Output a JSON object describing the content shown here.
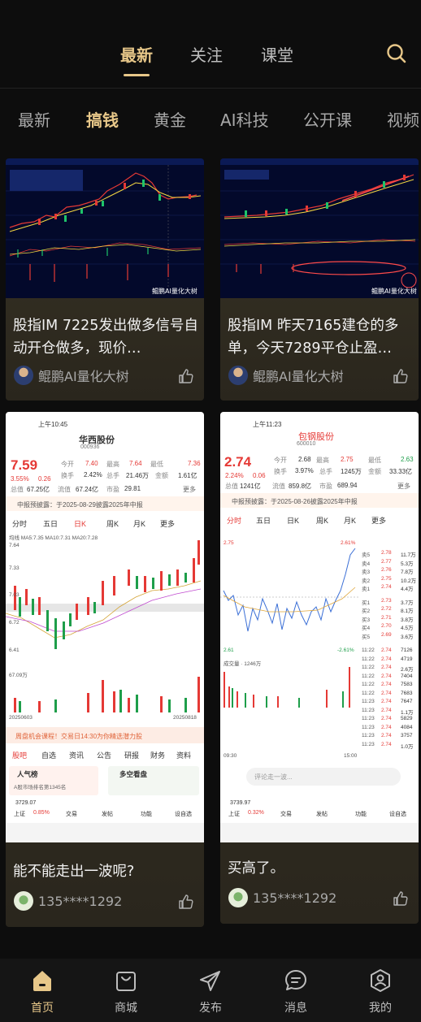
{
  "top_tabs": [
    {
      "label": "最新",
      "active": true
    },
    {
      "label": "关注",
      "active": false
    },
    {
      "label": "课堂",
      "active": false
    }
  ],
  "sub_tabs": [
    {
      "label": "最新",
      "active": false
    },
    {
      "label": "搞钱",
      "active": true
    },
    {
      "label": "黄金",
      "active": false
    },
    {
      "label": "AI科技",
      "active": false
    },
    {
      "label": "公开课",
      "active": false
    },
    {
      "label": "视频",
      "active": false
    }
  ],
  "cards": [
    {
      "title": "股指IM 7225发出做多信号自动开仓做多，现价…",
      "author": "鲲鹏AI量化大树",
      "watermark": "鲲鹏AI量化大树"
    },
    {
      "title": "股指IM 昨天7165建仓的多单，今天7289平仓止盈…",
      "author": "鲲鹏AI量化大树",
      "watermark": "鲲鹏AI量化大树"
    },
    {
      "title": "能不能走出一波呢?",
      "author": "135****1292"
    },
    {
      "title": "买高了。",
      "author": "135****1292"
    }
  ],
  "shot1": {
    "time": "上午10:45",
    "stock_name": "华西股份",
    "code": "000936",
    "price": "7.59",
    "chg_pct": "3.55%",
    "chg": "0.26",
    "open_label": "今开",
    "open": "7.40",
    "high_label": "最高",
    "high": "7.64",
    "low_label": "最低",
    "low": "7.36",
    "turnover_label": "换手",
    "turnover": "2.42%",
    "volume_label": "总手",
    "volume": "21.46万",
    "amount_label": "金额",
    "amount": "1.61亿",
    "mcap_label": "总值",
    "mcap": "67.25亿",
    "float_label": "流值",
    "float_mcap": "67.24亿",
    "pe_label": "市盈",
    "pe": "29.81",
    "more": "更多",
    "notice": "中报预披露：于2025-08-29披露2025年中报",
    "tabs": [
      "分时",
      "五日",
      "日K",
      "周K",
      "月K",
      "更多"
    ],
    "ma_line": "均线 MA5:7.35 MA10:7.31 MA20:7.28",
    "y_labels": [
      "7.64",
      "7.33",
      "7.03",
      "6.72",
      "6.41"
    ],
    "vol_label": "67.09万",
    "date_start": "20250603",
    "date_end": "20250818",
    "banner": "周盘机会课程！交易日14:30为你精选潜力股",
    "bottom_tabs": [
      "股吧",
      "自选",
      "资讯",
      "公告",
      "研报",
      "财务",
      "资料"
    ],
    "popular": "人气榜",
    "popular_sub": "A股市场排名第1345名",
    "bull_bear": "多空看盘",
    "index_name": "上证",
    "index_value": "3729.07",
    "index_pct": "0.85%",
    "nav": [
      "交易",
      "发帖",
      "功能",
      "设自选"
    ]
  },
  "shot2": {
    "time": "上午11:23",
    "stock_name": "包钢股份",
    "code": "600010",
    "price": "2.74",
    "chg_pct": "2.24%",
    "chg": "0.06",
    "open_label": "今开",
    "open": "2.68",
    "high_label": "最高",
    "high": "2.75",
    "low_label": "最低",
    "low": "2.63",
    "turnover_label": "换手",
    "turnover": "3.97%",
    "volume_label": "总手",
    "volume": "1245万",
    "amount_label": "金额",
    "amount": "33.33亿",
    "mcap_label": "总值",
    "mcap": "1241亿",
    "float_label": "流值",
    "float_mcap": "859.8亿",
    "pe_label": "市盈",
    "pe": "689.94",
    "more": "更多",
    "notice": "中报预披露：于2025-08-26披露2025年中报",
    "tabs": [
      "分时",
      "五日",
      "日K",
      "周K",
      "月K",
      "更多"
    ],
    "y_top": "2.75",
    "y_bottom": "2.61",
    "pct_top": "2.61%",
    "pct_bottom": "-2.61%",
    "order_book": [
      [
        "卖5",
        "2.78",
        "11.7万"
      ],
      [
        "卖4",
        "2.77",
        "5.3万"
      ],
      [
        "卖3",
        "2.76",
        "7.8万"
      ],
      [
        "卖2",
        "2.75",
        "10.2万"
      ],
      [
        "卖1",
        "2.74",
        "4.4万"
      ],
      [
        "买1",
        "2.73",
        "3.7万"
      ],
      [
        "买2",
        "2.72",
        "8.1万"
      ],
      [
        "买3",
        "2.71",
        "3.8万"
      ],
      [
        "买4",
        "2.70",
        "4.5万"
      ],
      [
        "买5",
        "2.69",
        "3.6万"
      ]
    ],
    "ticks": [
      [
        "11:22",
        "2.74",
        "7126"
      ],
      [
        "11:22",
        "2.74",
        "4719"
      ],
      [
        "11:22",
        "2.74",
        "2.6万"
      ],
      [
        "11:22",
        "2.74",
        "7404"
      ],
      [
        "11:22",
        "2.74",
        "7583"
      ],
      [
        "11:22",
        "2.74",
        "7683"
      ],
      [
        "11:23",
        "2.74",
        "7647"
      ],
      [
        "11:23",
        "2.74",
        "1.1万"
      ],
      [
        "11:23",
        "2.74",
        "5829"
      ],
      [
        "11:23",
        "2.74",
        "4084"
      ],
      [
        "11:23",
        "2.74",
        "3757"
      ],
      [
        "11:23",
        "2.74",
        "1.0万"
      ]
    ],
    "vol_line": "成交量 · 1246万",
    "times": [
      "09:30",
      "15:00"
    ],
    "comment_placeholder": "评论走一波...",
    "index_name": "上证",
    "index_value": "3739.97",
    "index_pct": "0.32%",
    "nav": [
      "交易",
      "发帖",
      "功能",
      "设自选"
    ]
  },
  "bottom_nav": [
    {
      "label": "首页",
      "icon": "home-icon",
      "active": true
    },
    {
      "label": "商城",
      "icon": "shopping-bag-icon",
      "active": false
    },
    {
      "label": "发布",
      "icon": "paper-plane-icon",
      "active": false
    },
    {
      "label": "消息",
      "icon": "message-icon",
      "active": false
    },
    {
      "label": "我的",
      "icon": "profile-icon",
      "active": false
    }
  ],
  "colors": {
    "accent": "#e7c789",
    "background": "#0d0d0d",
    "card": "#2e2a20",
    "up": "#e53935",
    "down": "#1e9e4a"
  }
}
